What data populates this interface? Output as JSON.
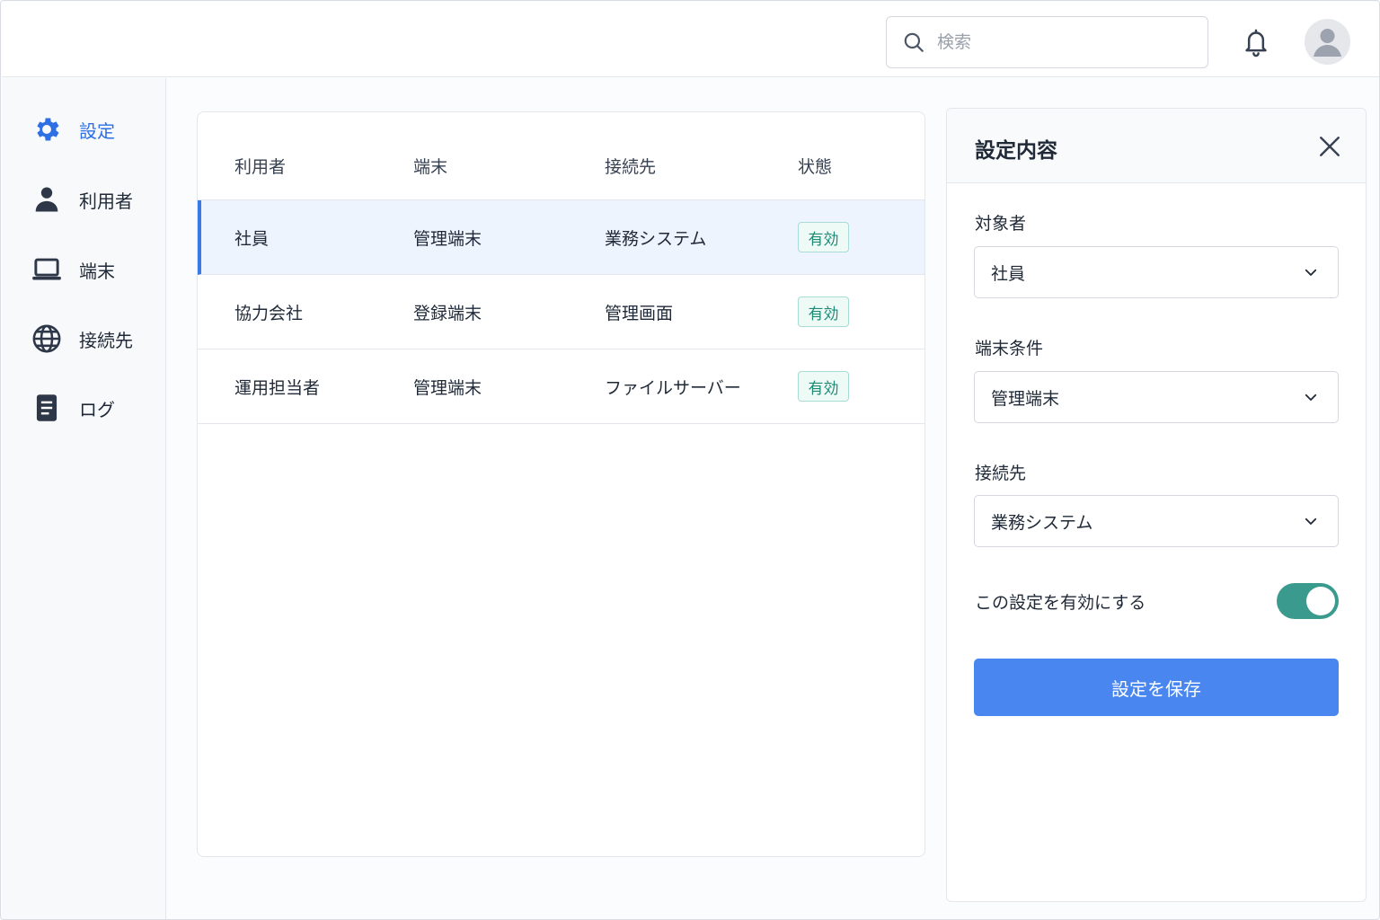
{
  "header": {
    "search": {
      "placeholder": "検索",
      "value": ""
    },
    "icons": [
      "search-icon",
      "bell-icon",
      "user-avatar"
    ]
  },
  "sidebar": {
    "items": [
      {
        "label": "設定",
        "icon": "gear-icon",
        "active": true
      },
      {
        "label": "利用者",
        "icon": "user-icon",
        "active": false
      },
      {
        "label": "端末",
        "icon": "laptop-icon",
        "active": false
      },
      {
        "label": "接続先",
        "icon": "globe-icon",
        "active": false
      },
      {
        "label": "ログ",
        "icon": "document-icon",
        "active": false
      }
    ]
  },
  "table": {
    "columns": [
      "利用者",
      "端末",
      "接続先",
      "状態"
    ],
    "rows": [
      {
        "user": "社員",
        "device": "管理端末",
        "destination": "業務システム",
        "status": "有効",
        "selected": true
      },
      {
        "user": "協力会社",
        "device": "登録端末",
        "destination": "管理画面",
        "status": "有効",
        "selected": false
      },
      {
        "user": "運用担当者",
        "device": "管理端末",
        "destination": "ファイルサーバー",
        "status": "有効",
        "selected": false
      }
    ]
  },
  "panel": {
    "title": "設定内容",
    "fields": [
      {
        "label": "対象者",
        "value": "社員"
      },
      {
        "label": "端末条件",
        "value": "管理端末"
      },
      {
        "label": "接続先",
        "value": "業務システム"
      }
    ],
    "toggle": {
      "label": "この設定を有効にする",
      "on": true
    },
    "save_label": "設定を保存"
  },
  "colors": {
    "accent": "#2f6fe4",
    "button": "#4a86ef",
    "toggle_on": "#3b9a8e",
    "badge_text": "#1d8a74",
    "selected_row": "#eef4fe"
  }
}
